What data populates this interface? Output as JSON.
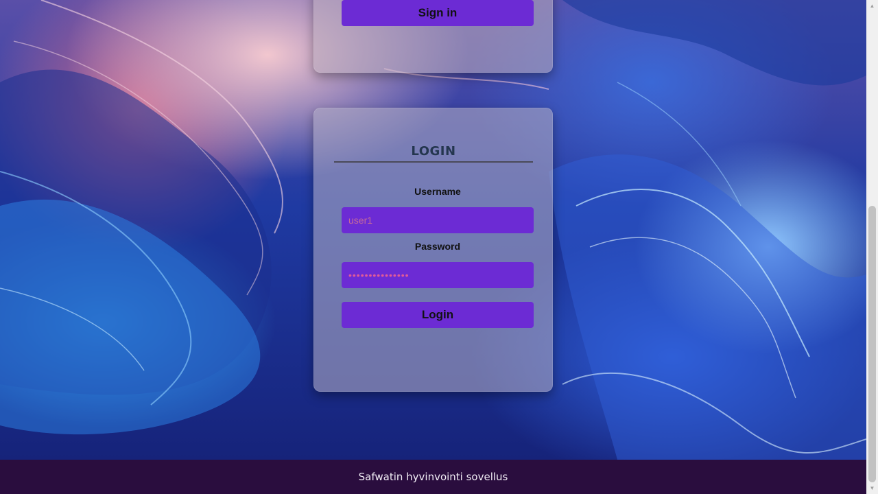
{
  "signin_card": {
    "button_label": "Sign in"
  },
  "login_card": {
    "title": "LOGIN",
    "username": {
      "label": "Username",
      "value": "user1",
      "placeholder": ""
    },
    "password": {
      "label": "Password",
      "value": "•••••••••••••••",
      "placeholder": ""
    },
    "button_label": "Login"
  },
  "footer": {
    "text": "Safwatin hyvinvointi sovellus"
  },
  "colors": {
    "button": "#6c2bd4",
    "footer_bg": "#2a0d3e",
    "title": "#24364f",
    "input_text": "#c46a9a"
  },
  "icons": {
    "scroll_up": "chevron-up-icon",
    "scroll_down": "chevron-down-icon"
  }
}
